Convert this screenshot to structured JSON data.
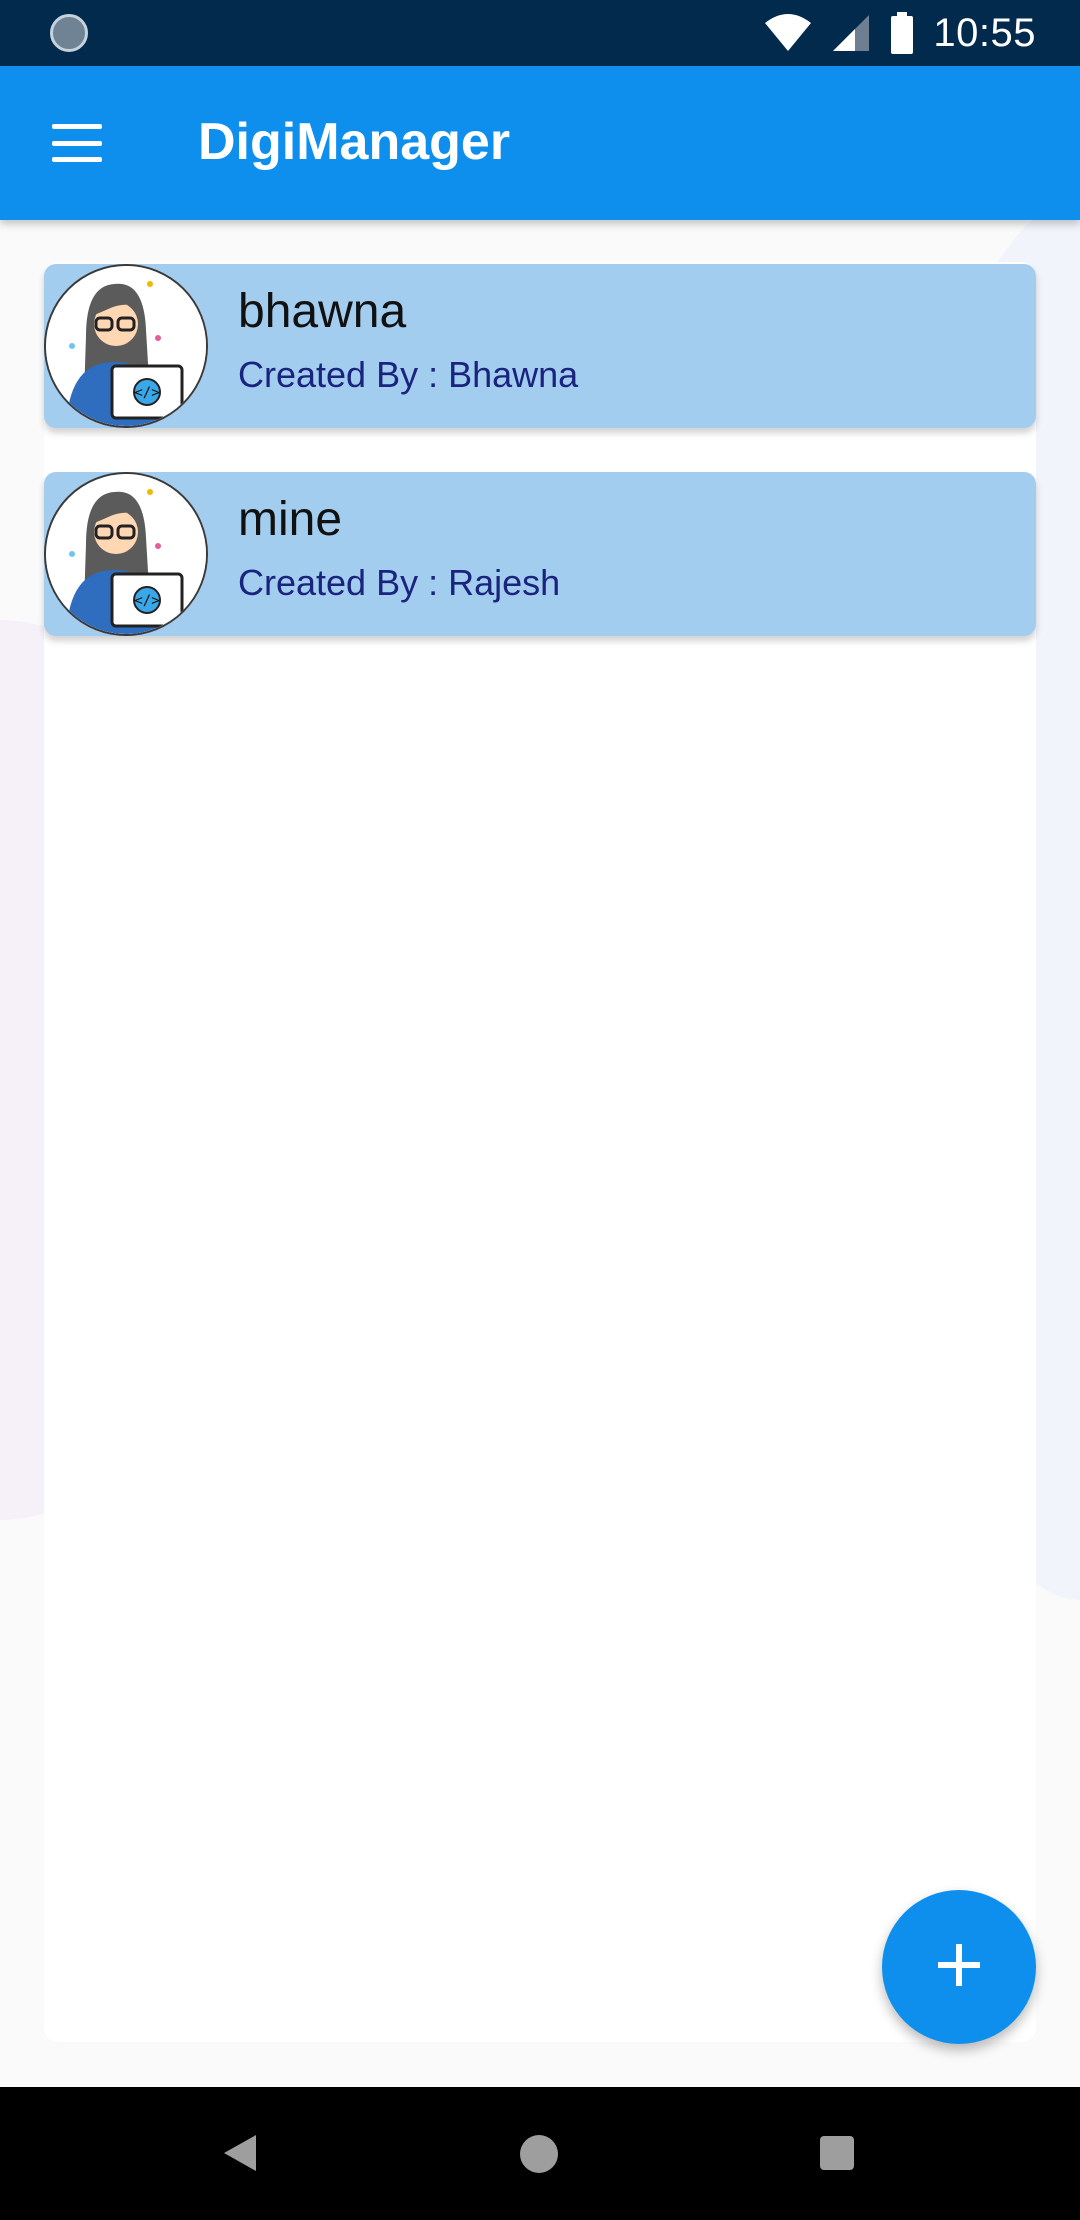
{
  "status_bar": {
    "time": "10:55",
    "icons": [
      "sync-icon",
      "wifi-icon",
      "signal-icon",
      "battery-icon"
    ]
  },
  "app_bar": {
    "title": "DigiManager",
    "menu_icon": "hamburger-menu-icon"
  },
  "list": {
    "items": [
      {
        "title": "bhawna",
        "subtitle_prefix": "Created By :",
        "creator": "Bhawna",
        "avatar": "developer-avatar-icon"
      },
      {
        "title": "mine",
        "subtitle_prefix": "Created By :",
        "creator": "Rajesh",
        "avatar": "developer-avatar-icon"
      }
    ]
  },
  "fab": {
    "icon": "plus-icon"
  },
  "nav_bar": {
    "icons": [
      "back-icon",
      "home-icon",
      "recents-icon"
    ]
  },
  "colors": {
    "status_bar": "#022a4d",
    "primary": "#0e8fee",
    "card": "#a3cdef",
    "subtitle_text": "#1a237e"
  }
}
